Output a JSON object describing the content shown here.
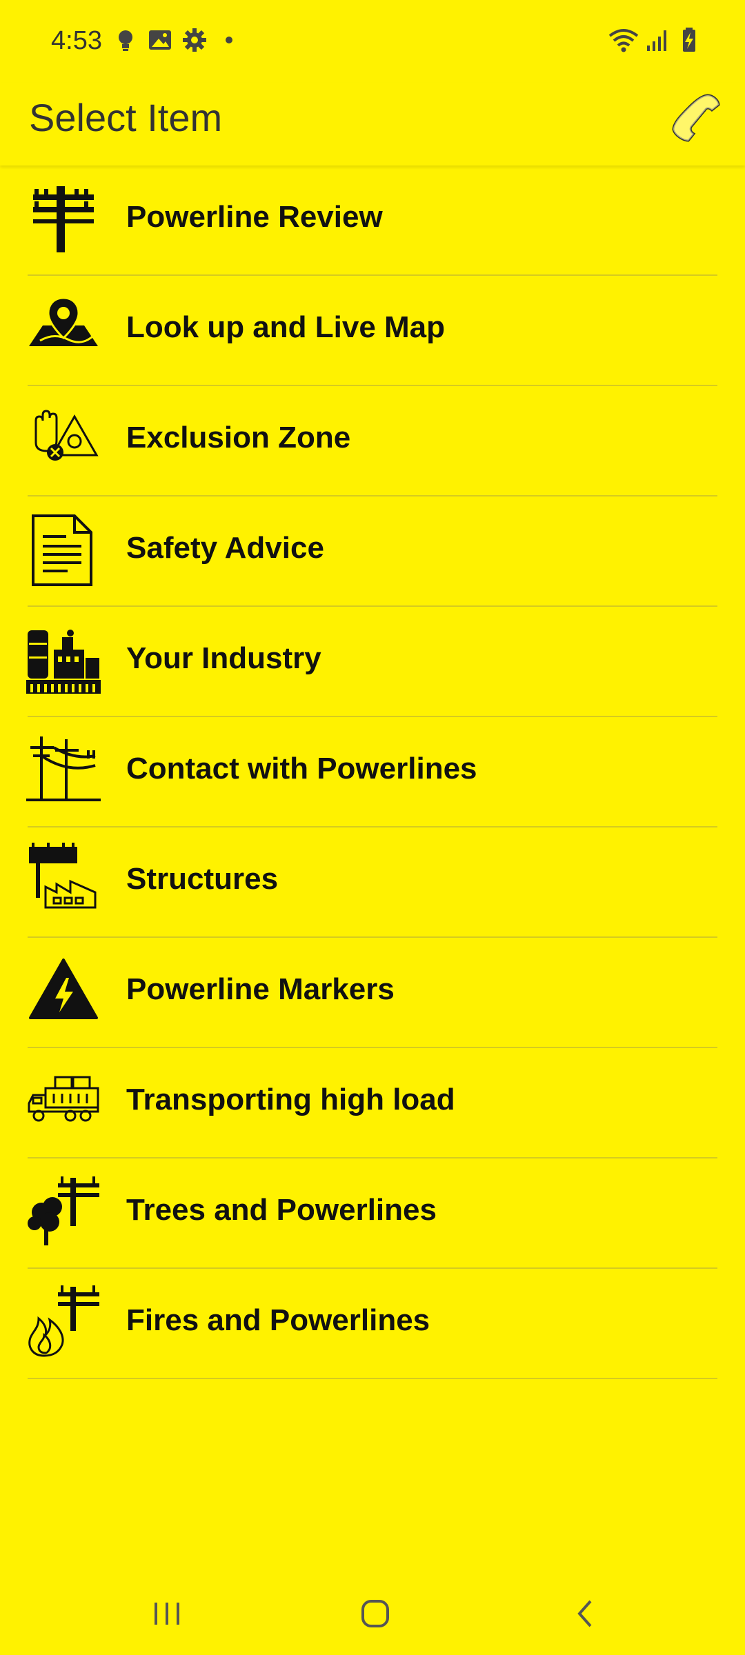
{
  "status_bar": {
    "time": "4:53",
    "icons_left": [
      "bulb-icon",
      "image-icon",
      "gear-icon",
      "dot-icon"
    ],
    "icons_right": [
      "wifi-icon",
      "signal-icon",
      "battery-charging-icon"
    ]
  },
  "app_bar": {
    "title": "Select Item",
    "action_icon": "phone-icon"
  },
  "menu": {
    "items": [
      {
        "label": "Powerline Review",
        "icon": "power-pole-icon"
      },
      {
        "label": "Look up and Live Map",
        "icon": "map-pin-icon"
      },
      {
        "label": "Exclusion Zone",
        "icon": "hazard-hand-icon"
      },
      {
        "label": "Safety Advice",
        "icon": "document-icon"
      },
      {
        "label": "Your Industry",
        "icon": "factory-icon"
      },
      {
        "label": "Contact with Powerlines",
        "icon": "powerlines-icon"
      },
      {
        "label": "Structures",
        "icon": "structures-icon"
      },
      {
        "label": "Powerline Markers",
        "icon": "high-voltage-warning-icon"
      },
      {
        "label": "Transporting high load",
        "icon": "truck-icon"
      },
      {
        "label": "Trees and Powerlines",
        "icon": "tree-pole-icon"
      },
      {
        "label": "Fires and Powerlines",
        "icon": "fire-pole-icon"
      }
    ]
  },
  "nav_bar": {
    "buttons": [
      "recents-icon",
      "home-icon",
      "back-icon"
    ]
  },
  "colors": {
    "background": "#FFF200",
    "text": "#111111",
    "divider": "#D6CB1F"
  }
}
